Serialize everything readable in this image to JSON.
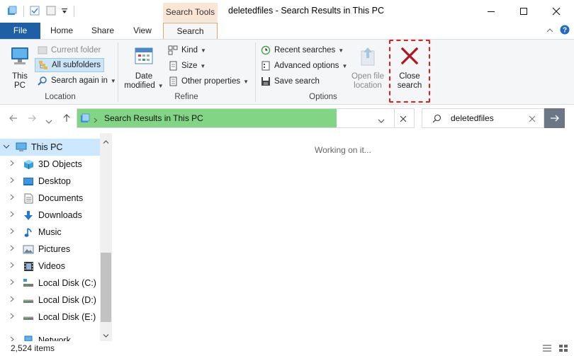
{
  "window": {
    "title": "deletedfiles - Search Results in This PC",
    "context_tab_header": "Search Tools"
  },
  "tabs": {
    "file": "File",
    "home": "Home",
    "share": "Share",
    "view": "View",
    "search": "Search"
  },
  "ribbon": {
    "location": {
      "label": "Location",
      "this_pc": [
        "This",
        "PC"
      ],
      "current_folder": "Current folder",
      "all_subfolders": "All subfolders",
      "search_again_in": "Search again in"
    },
    "refine": {
      "label": "Refine",
      "date_modified": [
        "Date",
        "modified"
      ],
      "kind": "Kind",
      "size": "Size",
      "other_properties": "Other properties"
    },
    "options": {
      "label": "Options",
      "recent_searches": "Recent searches",
      "advanced_options": "Advanced options",
      "save_search": "Save search",
      "open_file_location": [
        "Open file",
        "location"
      ]
    },
    "close_search": [
      "Close",
      "search"
    ]
  },
  "address": {
    "path": "Search Results in This PC",
    "progress": 0.77
  },
  "search": {
    "value": "deletedfiles"
  },
  "nav": {
    "items": [
      {
        "label": "This PC"
      },
      {
        "label": "3D Objects"
      },
      {
        "label": "Desktop"
      },
      {
        "label": "Documents"
      },
      {
        "label": "Downloads"
      },
      {
        "label": "Music"
      },
      {
        "label": "Pictures"
      },
      {
        "label": "Videos"
      },
      {
        "label": "Local Disk (C:)"
      },
      {
        "label": "Local Disk (D:)"
      },
      {
        "label": "Local Disk (E:)"
      },
      {
        "label": "Network"
      }
    ]
  },
  "content": {
    "message": "Working on it..."
  },
  "status": {
    "count": "2,524 items"
  },
  "colors": {
    "file_tab": "#1e5fa5",
    "context_tab": "#fbe6d3",
    "search_progress": "#83d586",
    "highlight": "#e02020"
  }
}
